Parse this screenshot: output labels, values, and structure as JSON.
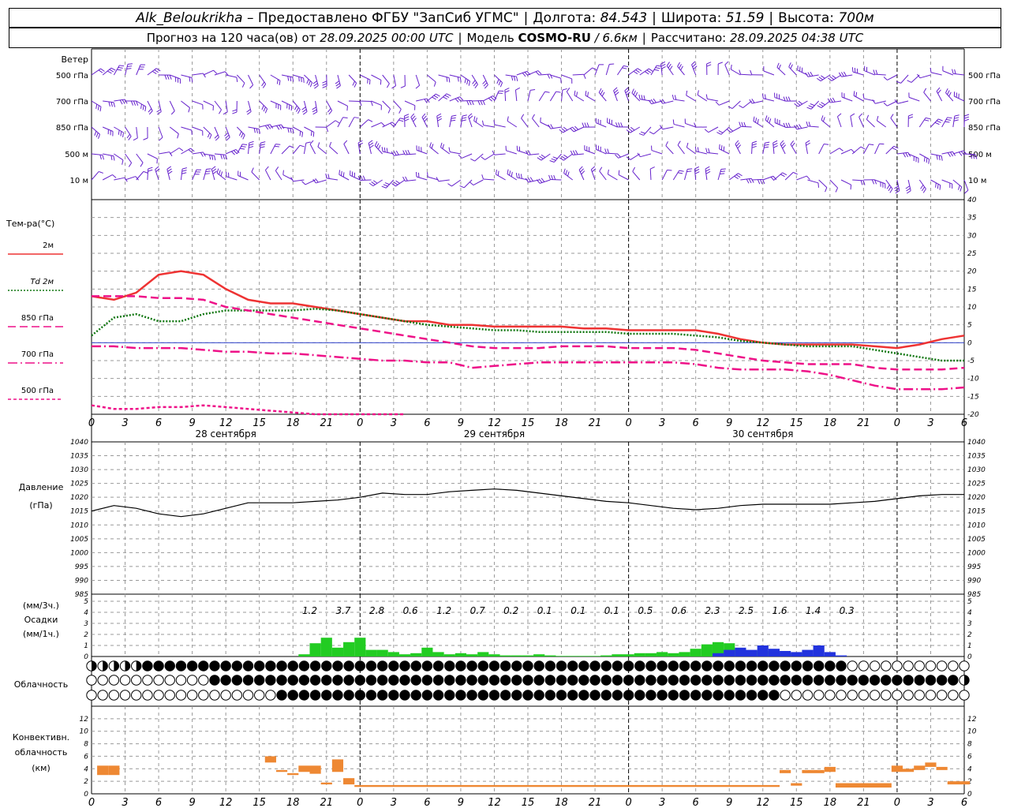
{
  "header": {
    "station": "Alk_Beloukrikha",
    "provided": "– Предоставлено ФГБУ \"ЗапСиб УГМС\"",
    "lon_label": "Долгота:",
    "lon": "84.543",
    "lat_label": "Широта:",
    "lat": "51.59",
    "alt_label": "Высота:",
    "alt": "700м",
    "forecast_label": "Прогноз на 120 часа(ов) от",
    "forecast_start": "28.09.2025 00:00 UTC",
    "model_label": "Модель",
    "model": "COSMO-RU",
    "model_res": "/ 6.6км",
    "calc_label": "Рассчитано:",
    "calc_time": "28.09.2025 04:38 UTC"
  },
  "labels": {
    "wind": "Ветер",
    "levels": [
      "500 гПа",
      "700 гПа",
      "850 гПа",
      "500 м",
      "10 м"
    ],
    "temp": "Тем-ра(°С)",
    "pressure": "Давление",
    "pressure_unit": "(гПа)",
    "precip_unit3": "(мм/3ч.)",
    "precip": "Осадки",
    "precip_unit1": "(мм/1ч.)",
    "cloud": "Облачность",
    "conv1": "Конвективн.",
    "conv2": "облачность",
    "conv3": "(км)"
  },
  "legend": [
    {
      "name": "2м",
      "color": "#ee3333",
      "style": "solid"
    },
    {
      "name": "Td 2м",
      "color": "#117711",
      "style": "dot"
    },
    {
      "name": "850 гПа",
      "color": "#ee1188",
      "style": "dash"
    },
    {
      "name": "700 гПа",
      "color": "#ee1188",
      "style": "dashdot"
    },
    {
      "name": "500 гПа",
      "color": "#ee1188",
      "style": "shortdash"
    }
  ],
  "time_ticks": [
    "0",
    "3",
    "6",
    "9",
    "12",
    "15",
    "18",
    "21",
    "0",
    "3",
    "6",
    "9",
    "12",
    "15",
    "18",
    "21",
    "0",
    "3",
    "6",
    "9",
    "12",
    "15",
    "18",
    "21",
    "0",
    "3",
    "6"
  ],
  "day_labels": [
    "28 сентября",
    "29 сентября",
    "30 сентября"
  ],
  "day_label_hours": [
    12,
    36,
    60
  ],
  "chart_data": [
    {
      "type": "line",
      "title": "Тем-ра(°С)",
      "x_hours": [
        0,
        2,
        4,
        6,
        8,
        10,
        12,
        14,
        16,
        18,
        20,
        22,
        24,
        26,
        28,
        30,
        32,
        34,
        36,
        38,
        40,
        42,
        44,
        46,
        48,
        50,
        52,
        54,
        56,
        58,
        60,
        62,
        64,
        66,
        68,
        70,
        72,
        74,
        76,
        78
      ],
      "ylim": [
        -20,
        40
      ],
      "yticks": [
        -20,
        -15,
        -10,
        -5,
        0,
        5,
        10,
        15,
        20,
        25,
        30,
        35,
        40
      ],
      "series": [
        {
          "name": "2м",
          "values": [
            13,
            12,
            14,
            19,
            20,
            19,
            15,
            12,
            11,
            11,
            10,
            9,
            8,
            7,
            6,
            6,
            5,
            5,
            4.5,
            4.5,
            4.5,
            4.5,
            4,
            4,
            3.5,
            3.5,
            3.5,
            3.5,
            2.5,
            1,
            0,
            -0.5,
            -0.5,
            -0.5,
            -0.5,
            -1,
            -1.5,
            -0.5,
            1,
            2
          ]
        },
        {
          "name": "Td 2м",
          "values": [
            2,
            7,
            8,
            6,
            6,
            8,
            9,
            9,
            9,
            9,
            9.5,
            9,
            8,
            7,
            6,
            5,
            4.5,
            4,
            3.5,
            3.5,
            3,
            3,
            3,
            3,
            2.5,
            2.5,
            2.5,
            2,
            1.5,
            0.5,
            0,
            -0.5,
            -1,
            -1,
            -1,
            -2,
            -3,
            -4,
            -5,
            -5
          ]
        },
        {
          "name": "850 гПа",
          "values": [
            13,
            13,
            13,
            12.5,
            12.5,
            12,
            10,
            9,
            8,
            7,
            6,
            5,
            4,
            3,
            2,
            1,
            0,
            -1,
            -1.5,
            -1.5,
            -1.5,
            -1,
            -1,
            -1,
            -1.5,
            -1.5,
            -1.5,
            -2,
            -3,
            -4,
            -5,
            -5.5,
            -6,
            -6,
            -6,
            -7,
            -7.5,
            -7.5,
            -7.5,
            -7
          ]
        },
        {
          "name": "700 гПа",
          "values": [
            -1,
            -1,
            -1.5,
            -1.5,
            -1.5,
            -2,
            -2.5,
            -2.5,
            -3,
            -3,
            -3.5,
            -4,
            -4.5,
            -5,
            -5,
            -5.5,
            -5.5,
            -7,
            -6.5,
            -6,
            -5.5,
            -5.5,
            -5.5,
            -5.5,
            -5.5,
            -5.5,
            -5.5,
            -6,
            -7,
            -7.5,
            -7.5,
            -7.5,
            -8,
            -9,
            -10.5,
            -12,
            -13,
            -13,
            -13,
            -12.5
          ]
        },
        {
          "name": "500 гПа",
          "x_hours": [
            0,
            2,
            4,
            6,
            8,
            10,
            12,
            14,
            16,
            18,
            20,
            22,
            24,
            26,
            28
          ],
          "values": [
            -17.5,
            -18.5,
            -18.5,
            -18,
            -18,
            -17.5,
            -18,
            -18.5,
            -19,
            -19.5,
            -20,
            -20,
            -20,
            -20,
            -20
          ]
        }
      ]
    },
    {
      "type": "line",
      "title": "Давление",
      "x_hours": [
        0,
        2,
        4,
        6,
        8,
        10,
        12,
        14,
        16,
        18,
        20,
        22,
        24,
        26,
        28,
        30,
        32,
        34,
        36,
        38,
        40,
        42,
        44,
        46,
        48,
        50,
        52,
        54,
        56,
        58,
        60,
        62,
        64,
        66,
        68,
        70,
        72,
        74,
        76,
        78
      ],
      "ylim": [
        985,
        1040
      ],
      "yticks": [
        985,
        990,
        995,
        1000,
        1005,
        1010,
        1015,
        1020,
        1025,
        1030,
        1035,
        1040
      ],
      "values": [
        1015,
        1017,
        1016,
        1014,
        1013,
        1014,
        1016,
        1018,
        1018,
        1018,
        1018.5,
        1019,
        1020,
        1021.5,
        1021,
        1021,
        1022,
        1022.5,
        1023,
        1022.5,
        1021.5,
        1020.5,
        1019.5,
        1018.5,
        1018,
        1017,
        1016,
        1015.5,
        1016,
        1017,
        1017.5,
        1017.5,
        1017.5,
        1017.5,
        1018,
        1018.5,
        1019.5,
        1020.5,
        1021,
        1021
      ]
    },
    {
      "type": "bar",
      "title": "Осадки",
      "ylim": [
        0,
        5
      ],
      "three_hour_labels": [
        "1.2",
        "3.7",
        "2.8",
        "0.6",
        "1.2",
        "0.7",
        "0.2",
        "0.1",
        "0.1",
        "0.1",
        "0.5",
        "0.6",
        "2.3",
        "2.5",
        "1.6",
        "1.4",
        "0.3"
      ],
      "three_hour_label_hours": [
        19.5,
        22.5,
        25.5,
        28.5,
        31.5,
        34.5,
        37.5,
        40.5,
        43.5,
        46.5,
        49.5,
        52.5,
        55.5,
        58.5,
        61.5,
        64.5,
        67.5
      ],
      "rain_hourly": {
        "start_hour": 19,
        "values": [
          0.2,
          1.2,
          1.7,
          0.8,
          1.3,
          1.7,
          0.6,
          0.6,
          0.4,
          0.2,
          0.3,
          0.8,
          0.4,
          0.2,
          0.3,
          0.2,
          0.4,
          0.2,
          0.1,
          0.1,
          0.1,
          0.2,
          0.1,
          0.05,
          0.05,
          0.05,
          0.05,
          0.1,
          0.2,
          0.2,
          0.3,
          0.3,
          0.4,
          0.3,
          0.4,
          0.7,
          1.1,
          1.3,
          1.2,
          0.7,
          0.5,
          0.5,
          0.4,
          0.3,
          0.3,
          0.2,
          0.1,
          0.05
        ]
      },
      "snow_hourly": {
        "start_hour": 56,
        "values": [
          0.3,
          0.6,
          0.8,
          0.6,
          1.0,
          0.7,
          0.5,
          0.4,
          0.6,
          1.0,
          0.4,
          0.1
        ]
      },
      "colors": {
        "rain": "#22cc22",
        "snow": "#2233dd"
      }
    },
    {
      "type": "bar",
      "title": "Конвективн. облачность (км)",
      "ylim": [
        0,
        13
      ],
      "yticks": [
        0,
        2,
        4,
        6,
        8,
        10,
        12
      ],
      "segments": [
        {
          "from": 0.5,
          "to": 1.5,
          "base": 3,
          "top": 4.5
        },
        {
          "from": 1.5,
          "to": 2.5,
          "base": 3,
          "top": 4.5
        },
        {
          "from": 15.5,
          "to": 16.5,
          "base": 5,
          "top": 6
        },
        {
          "from": 16.5,
          "to": 17.5,
          "base": 3.5,
          "top": 3.8
        },
        {
          "from": 17.5,
          "to": 18.5,
          "base": 3,
          "top": 3.3
        },
        {
          "from": 18.5,
          "to": 19.5,
          "base": 3.5,
          "top": 4.5
        },
        {
          "from": 19.5,
          "to": 20.5,
          "base": 3.2,
          "top": 4.5
        },
        {
          "from": 20.5,
          "to": 21.5,
          "base": 1.5,
          "top": 1.8
        },
        {
          "from": 21.5,
          "to": 22.5,
          "base": 3.5,
          "top": 5.5
        },
        {
          "from": 22.5,
          "to": 23.5,
          "base": 1.5,
          "top": 2.5
        },
        {
          "from": 23.5,
          "to": 61.5,
          "base": 1.1,
          "top": 1.4
        },
        {
          "from": 61.5,
          "to": 62.5,
          "base": 3.3,
          "top": 3.8
        },
        {
          "from": 62.5,
          "to": 63.5,
          "base": 1.3,
          "top": 1.7
        },
        {
          "from": 63.5,
          "to": 65.5,
          "base": 3.3,
          "top": 3.8
        },
        {
          "from": 65.5,
          "to": 66.5,
          "base": 3.5,
          "top": 4.3
        },
        {
          "from": 66.5,
          "to": 71.5,
          "base": 1,
          "top": 1.7
        },
        {
          "from": 71.5,
          "to": 72.5,
          "base": 3.5,
          "top": 4.5
        },
        {
          "from": 72.5,
          "to": 73.5,
          "base": 3.5,
          "top": 4
        },
        {
          "from": 73.5,
          "to": 74.5,
          "base": 3.8,
          "top": 4.5
        },
        {
          "from": 74.5,
          "to": 75.5,
          "base": 4.3,
          "top": 5
        },
        {
          "from": 75.5,
          "to": 76.5,
          "base": 3.8,
          "top": 4.3
        },
        {
          "from": 76.5,
          "to": 78.5,
          "base": 1.5,
          "top": 2
        }
      ],
      "color": "#ee8833"
    }
  ],
  "colors": {
    "wind": "#6622cc",
    "grid": "#999999",
    "axis": "#000000"
  }
}
